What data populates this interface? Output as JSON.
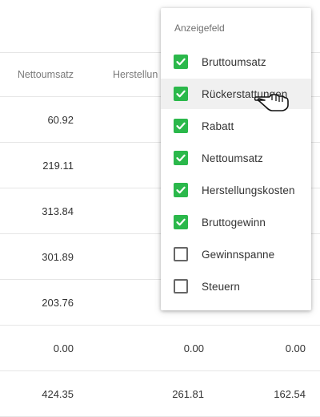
{
  "table": {
    "headers": [
      "Nettoumsatz",
      "Herstellun",
      ""
    ],
    "rows": [
      [
        "60.92",
        "",
        ""
      ],
      [
        "219.11",
        "",
        ""
      ],
      [
        "313.84",
        "",
        ""
      ],
      [
        "301.89",
        "",
        ""
      ],
      [
        "203.76",
        "",
        ""
      ],
      [
        "0.00",
        "0.00",
        "0.00"
      ],
      [
        "424.35",
        "261.81",
        "162.54"
      ]
    ]
  },
  "field_menu": {
    "title": "Anzeigefeld",
    "options": [
      {
        "label": "Bruttoumsatz",
        "checked": true
      },
      {
        "label": "Rückerstattungen",
        "checked": true,
        "hovered": true
      },
      {
        "label": "Rabatt",
        "checked": true
      },
      {
        "label": "Nettoumsatz",
        "checked": true
      },
      {
        "label": "Herstellungskosten",
        "checked": true
      },
      {
        "label": "Bruttogewinn",
        "checked": true
      },
      {
        "label": "Gewinnspanne",
        "checked": false
      },
      {
        "label": "Steuern",
        "checked": false
      }
    ]
  },
  "colors": {
    "checked": "#2bb84b",
    "hover_bg": "#f0f0f0"
  },
  "icons": {
    "checkbox_checked": "check-icon",
    "cursor": "hand-pointer-icon"
  }
}
